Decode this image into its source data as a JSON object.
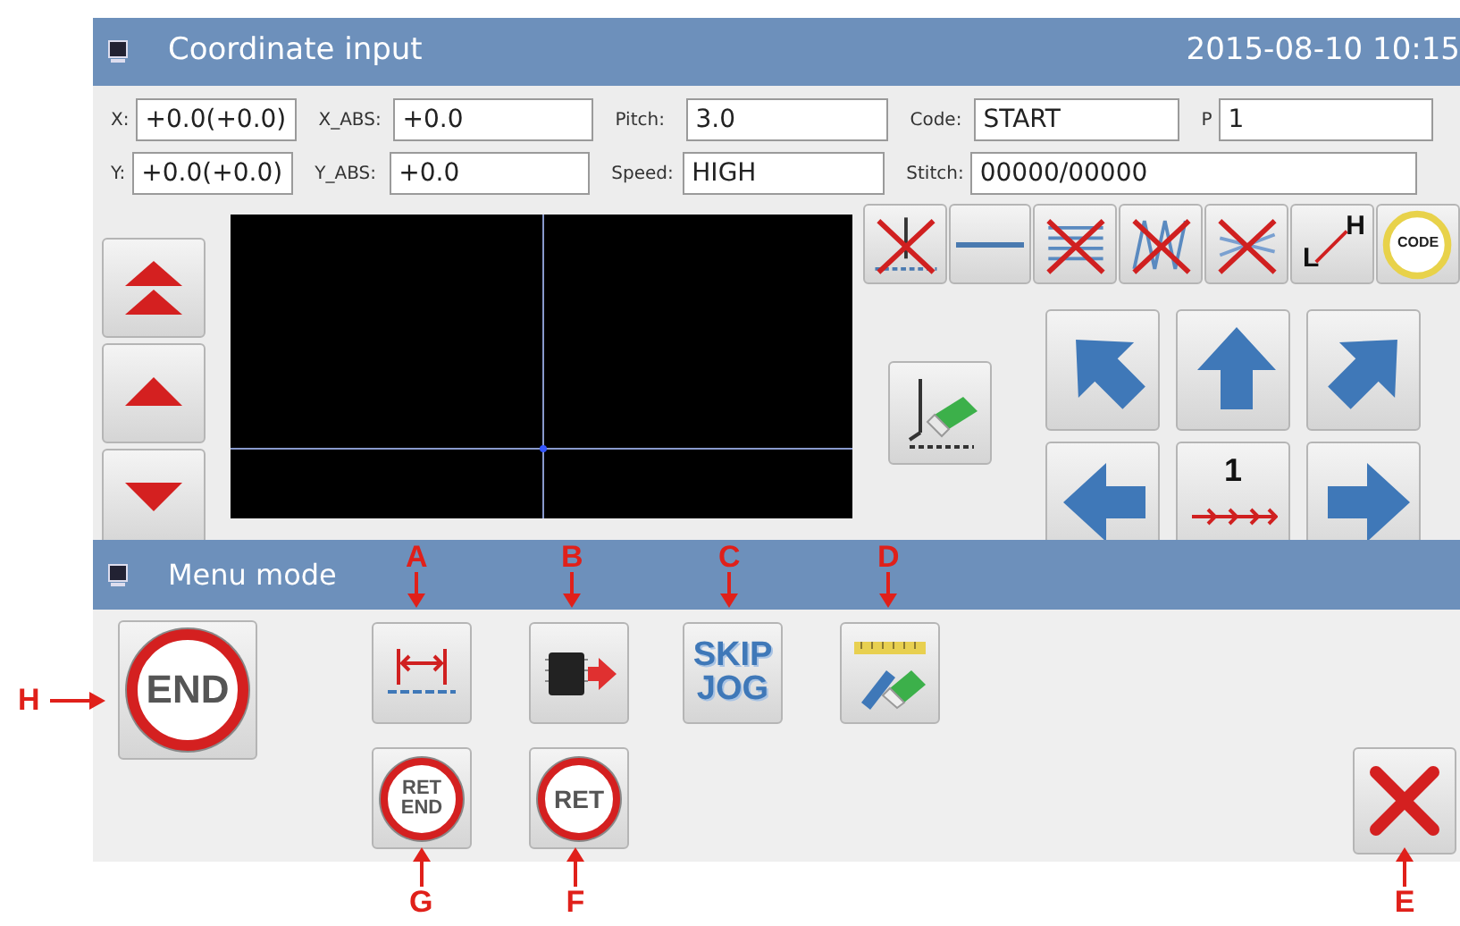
{
  "window": {
    "title": "Coordinate input",
    "datetime": "2015-08-10 10:15"
  },
  "field_rows": [
    [
      {
        "label": "X:",
        "value": "+0.0(+0.0)"
      },
      {
        "label": "X_ABS:",
        "value": "+0.0"
      },
      {
        "label": "Pitch:",
        "value": "3.0"
      },
      {
        "label": "Code:",
        "value": "START"
      },
      {
        "label": "P",
        "value": "1"
      }
    ],
    [
      {
        "label": "Y:",
        "value": "+0.0(+0.0)"
      },
      {
        "label": "Y_ABS:",
        "value": "+0.0"
      },
      {
        "label": "Speed:",
        "value": "HIGH"
      },
      {
        "label": "Stitch:",
        "value": "00000/00000"
      }
    ]
  ],
  "side_buttons": [
    {
      "kind": "double-up"
    },
    {
      "kind": "up"
    },
    {
      "kind": "down"
    }
  ],
  "toolbar": [
    {
      "kind": "cross-needle"
    },
    {
      "kind": "line"
    },
    {
      "kind": "cross-dense"
    },
    {
      "kind": "cross-zigzag"
    },
    {
      "kind": "cross-light"
    },
    {
      "kind": "lh",
      "label_low": "L",
      "label_high": "H"
    },
    {
      "kind": "code",
      "label": "CODE"
    }
  ],
  "jog_buttons": [
    {
      "kind": "up-left"
    },
    {
      "kind": "up"
    },
    {
      "kind": "up-right"
    },
    {
      "kind": "left"
    },
    {
      "kind": "step",
      "label": "1"
    },
    {
      "kind": "right"
    }
  ],
  "menu": {
    "title": "Menu mode",
    "buttons": [
      {
        "kind": "end",
        "label": "END"
      },
      {
        "kind": "width"
      },
      {
        "kind": "chip"
      },
      {
        "kind": "text",
        "label": "SKIP JOG"
      },
      {
        "kind": "ruler"
      },
      {
        "kind": "ret",
        "label": "RET END"
      },
      {
        "kind": "ret",
        "label": "RET"
      },
      {
        "kind": "close"
      }
    ]
  },
  "callouts": [
    {
      "letter": "A"
    },
    {
      "letter": "B"
    },
    {
      "letter": "C"
    },
    {
      "letter": "D"
    },
    {
      "letter": "H"
    },
    {
      "letter": "G"
    },
    {
      "letter": "F"
    },
    {
      "letter": "E"
    }
  ]
}
